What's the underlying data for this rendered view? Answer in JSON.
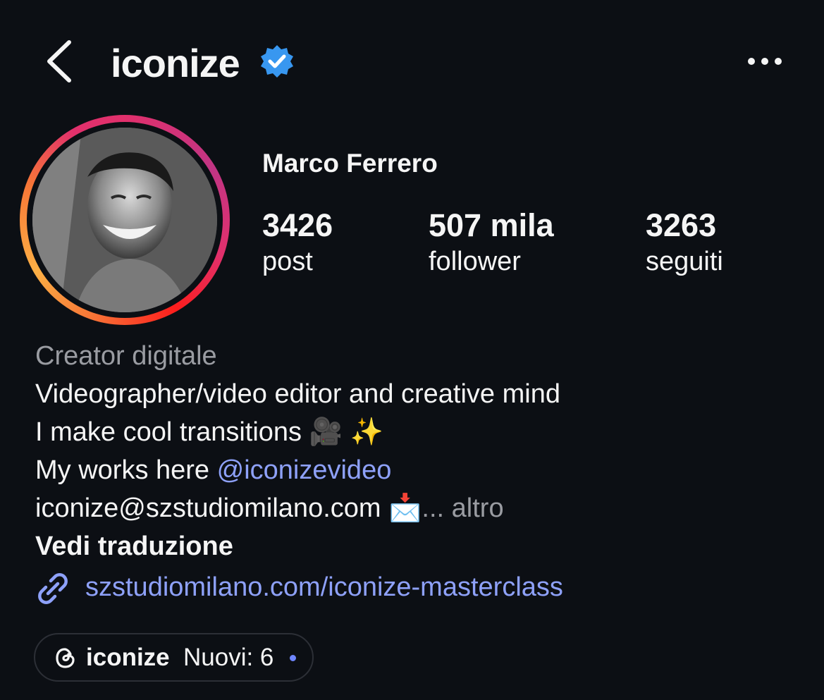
{
  "header": {
    "username": "iconize",
    "verified": true,
    "back_icon": "chevron-left-icon",
    "more_icon": "ellipsis-icon",
    "verified_color": "#3897f0"
  },
  "profile": {
    "display_name": "Marco Ferrero",
    "stats": [
      {
        "value": "3426",
        "label": "post"
      },
      {
        "value": "507 mila",
        "label": "follower"
      },
      {
        "value": "3263",
        "label": "seguiti"
      }
    ]
  },
  "bio": {
    "category": "Creator digitale",
    "line1": "Videographer/video editor and creative mind",
    "line2": "I make cool transitions 🎥 ✨",
    "line3_prefix": "My works here ",
    "line3_mention": "@iconizevideo",
    "line4": "iconize@szstudiomilano.com 📩",
    "line4_ellipsis": "...",
    "more": "altro",
    "see_translation": "Vedi traduzione"
  },
  "link": {
    "icon": "link-icon",
    "text": "szstudiomilano.com/iconize-masterclass"
  },
  "threads": {
    "icon": "threads-icon",
    "name": "iconize",
    "new_label": "Nuovi: 6"
  },
  "colors": {
    "background": "#0c0f14",
    "link": "#8ea1f9",
    "muted": "#9a9ca2"
  }
}
